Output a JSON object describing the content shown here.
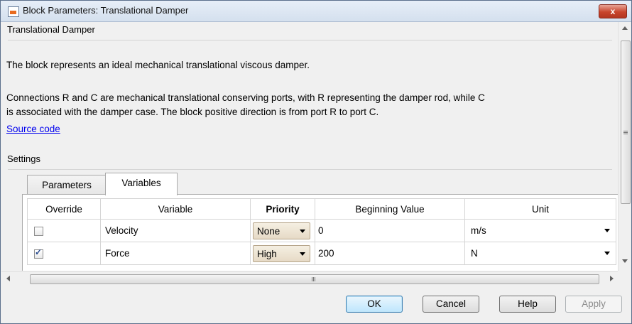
{
  "window": {
    "title": "Block Parameters: Translational Damper",
    "close_label": "x"
  },
  "description": {
    "header": "Translational Damper",
    "para1": "The block represents an ideal mechanical translational viscous damper.",
    "para2_line1": "Connections R and C are mechanical translational conserving ports, with R representing the damper rod, while C",
    "para2_line2": "is associated with the damper case. The block positive direction is from port R to port C.",
    "source_link": "Source code"
  },
  "settings": {
    "header": "Settings",
    "tabs": [
      {
        "label": "Parameters",
        "active": false
      },
      {
        "label": "Variables",
        "active": true
      }
    ],
    "table": {
      "columns": [
        "Override",
        "Variable",
        "Priority",
        "Beginning Value",
        "Unit"
      ],
      "rows": [
        {
          "override": false,
          "variable": "Velocity",
          "priority": "None",
          "beginning_value": "0",
          "unit": "m/s"
        },
        {
          "override": true,
          "variable": "Force",
          "priority": "High",
          "beginning_value": "200",
          "unit": "N"
        }
      ]
    }
  },
  "buttons": {
    "ok": "OK",
    "cancel": "Cancel",
    "help": "Help",
    "apply": "Apply"
  }
}
